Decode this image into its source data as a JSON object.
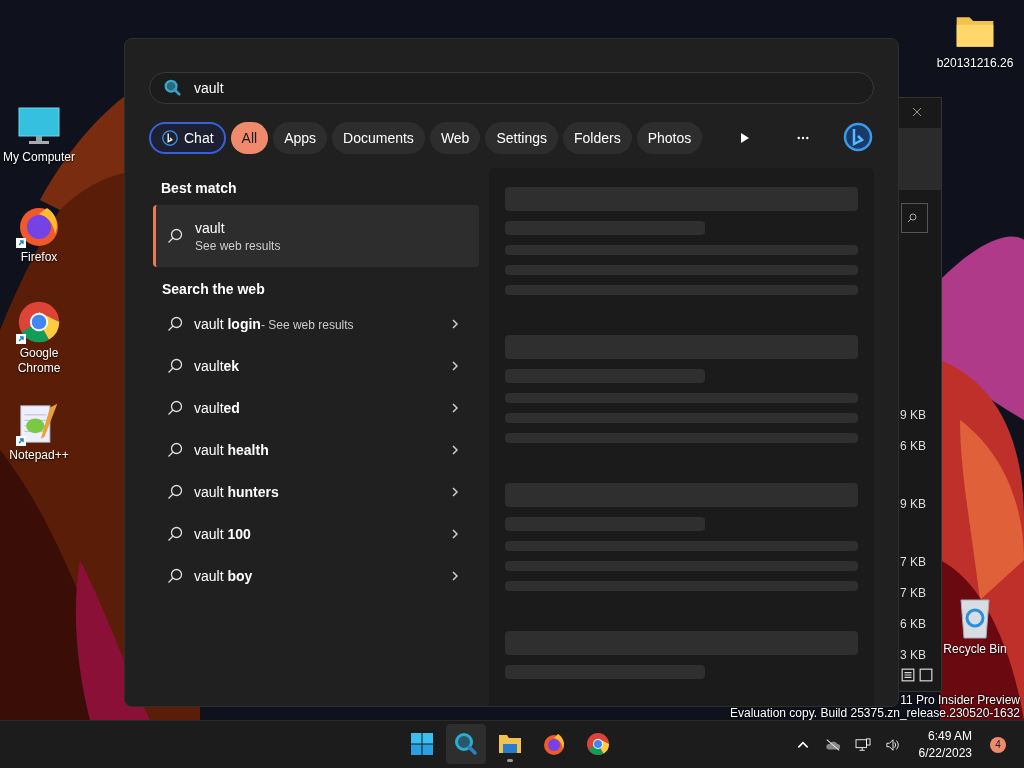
{
  "desktop_icons": [
    {
      "label": "My Computer",
      "kind": "computer",
      "shortcut": false
    },
    {
      "label": "Firefox",
      "kind": "firefox",
      "shortcut": true
    },
    {
      "label": "Google Chrome",
      "kind": "chrome",
      "shortcut": true
    },
    {
      "label": "Notepad++",
      "kind": "notepad",
      "shortcut": true
    },
    {
      "label": "b20131216.26",
      "kind": "folder",
      "shortcut": false
    },
    {
      "label": "Recycle Bin",
      "kind": "recycle",
      "shortcut": false
    }
  ],
  "background_window": {
    "file_sizes": [
      "9 KB",
      "6 KB",
      "9 KB",
      "7 KB",
      "7 KB",
      "6 KB",
      "3 KB"
    ]
  },
  "desktop_watermark": [
    "11 Pro Insider Preview",
    "Evaluation copy. Build 25375.zn_release.230520-1632"
  ],
  "search": {
    "query": "vault",
    "filters": [
      {
        "label": "Chat",
        "kind": "chat",
        "selected": false
      },
      {
        "label": "All",
        "kind": "filter",
        "selected": true
      },
      {
        "label": "Apps",
        "kind": "filter",
        "selected": false
      },
      {
        "label": "Documents",
        "kind": "filter",
        "selected": false
      },
      {
        "label": "Web",
        "kind": "filter",
        "selected": false
      },
      {
        "label": "Settings",
        "kind": "filter",
        "selected": false
      },
      {
        "label": "Folders",
        "kind": "filter",
        "selected": false
      },
      {
        "label": "Photos",
        "kind": "filter",
        "selected": false
      }
    ],
    "best_match": {
      "heading": "Best match",
      "title": "vault",
      "subtitle": "See web results",
      "selected": true
    },
    "web": {
      "heading": "Search the web",
      "suggestions": [
        {
          "text": "vault **login**",
          "suffix": "- See web results"
        },
        {
          "text": "vault**ek**"
        },
        {
          "text": "vault**ed**"
        },
        {
          "text": "vault **health**"
        },
        {
          "text": "vault **hunters**"
        },
        {
          "text": "vault **100**"
        },
        {
          "text": "vault **boy**"
        }
      ]
    }
  },
  "taskbar": {
    "apps": [
      {
        "kind": "start",
        "selected": false,
        "running": false
      },
      {
        "kind": "search",
        "selected": true,
        "running": false
      },
      {
        "kind": "explorer",
        "selected": false,
        "running": true
      },
      {
        "kind": "firefox",
        "selected": false,
        "running": false
      },
      {
        "kind": "chrome",
        "selected": false,
        "running": false
      }
    ],
    "clock": {
      "time": "6:49 AM",
      "date": "6/22/2023"
    },
    "notification_count": "4"
  }
}
